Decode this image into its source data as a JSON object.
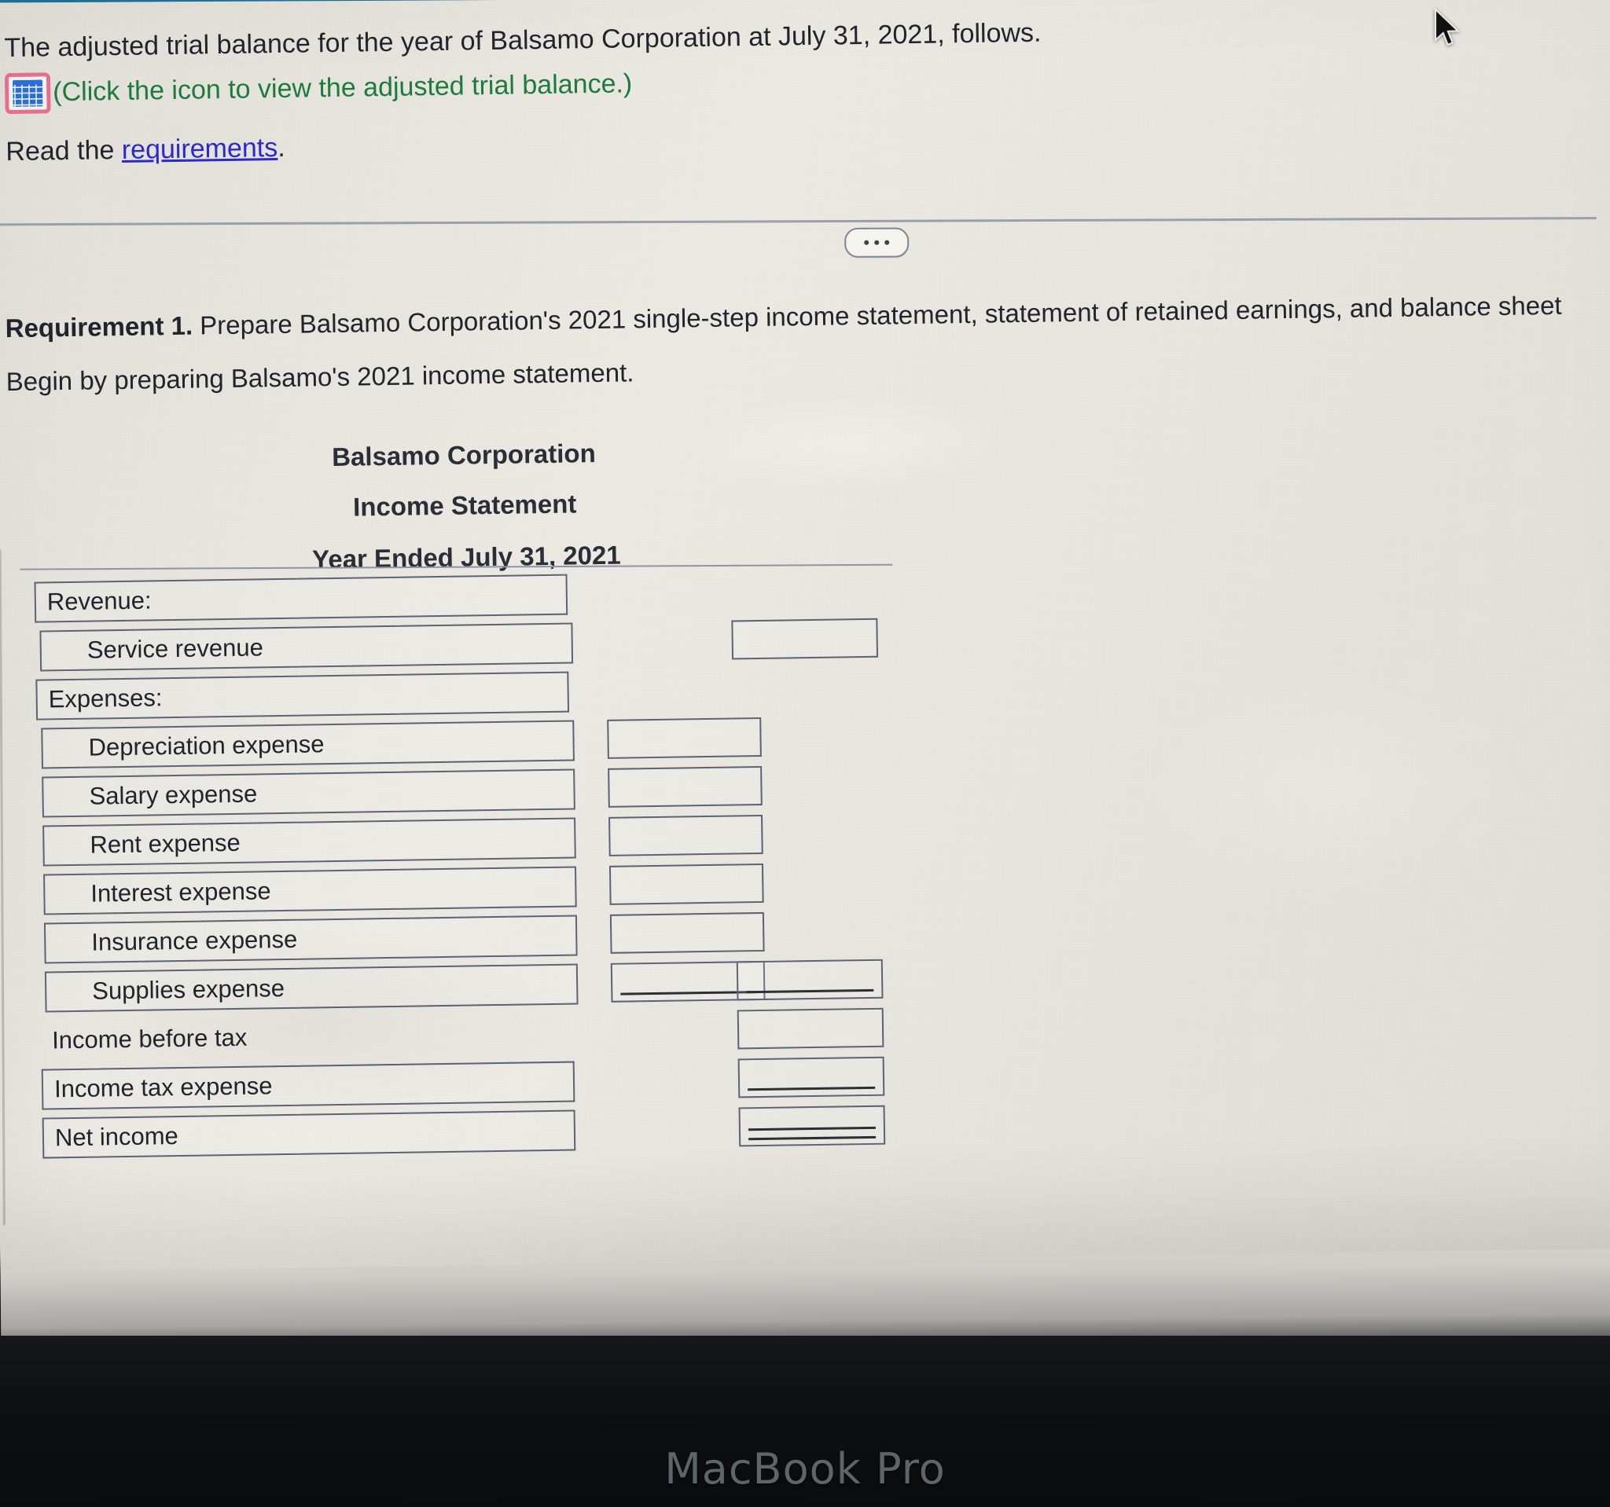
{
  "device": {
    "brand_label": "MacBook Pro"
  },
  "prompt": {
    "line1": "The adjusted trial balance for the year of Balsamo Corporation at July 31, 2021, follows.",
    "icon_name": "trial-balance-grid-icon",
    "icon_hint": "(Click the icon to view the adjusted trial balance.)",
    "read_prefix": "Read the ",
    "read_link": "requirements",
    "read_suffix": "."
  },
  "toolbar": {
    "ellipsis_label": "..."
  },
  "requirement": {
    "label": "Requirement 1.",
    "text": " Prepare Balsamo Corporation's 2021 single-step income statement, statement of retained earnings, and balance sheet",
    "begin": "Begin by preparing Balsamo's 2021 income statement."
  },
  "statement": {
    "company": "Balsamo Corporation",
    "title": "Income Statement",
    "period": "Year Ended July 31, 2021",
    "rows": [
      {
        "label": "Revenue:",
        "indent": 0,
        "boxed": true,
        "mid": false,
        "right": false,
        "underline": "none"
      },
      {
        "label": "Service revenue",
        "indent": 1,
        "boxed": true,
        "mid": false,
        "right": true,
        "underline": "none"
      },
      {
        "label": "Expenses:",
        "indent": 0,
        "boxed": true,
        "mid": false,
        "right": false,
        "underline": "none"
      },
      {
        "label": "Depreciation expense",
        "indent": 1,
        "boxed": true,
        "mid": true,
        "right": false,
        "underline": "none"
      },
      {
        "label": "Salary expense",
        "indent": 1,
        "boxed": true,
        "mid": true,
        "right": false,
        "underline": "none"
      },
      {
        "label": "Rent expense",
        "indent": 1,
        "boxed": true,
        "mid": true,
        "right": false,
        "underline": "none"
      },
      {
        "label": "Interest expense",
        "indent": 1,
        "boxed": true,
        "mid": true,
        "right": false,
        "underline": "none"
      },
      {
        "label": "Insurance expense",
        "indent": 1,
        "boxed": true,
        "mid": true,
        "right": false,
        "underline": "none"
      },
      {
        "label": "Supplies expense",
        "indent": 1,
        "boxed": true,
        "mid": true,
        "right": true,
        "underline": "single-both"
      },
      {
        "label": "Income before tax",
        "indent": 0,
        "boxed": false,
        "mid": false,
        "right": true,
        "underline": "none"
      },
      {
        "label": "Income tax expense",
        "indent": 0,
        "boxed": true,
        "mid": false,
        "right": true,
        "underline": "single-right"
      },
      {
        "label": "Net income",
        "indent": 0,
        "boxed": true,
        "mid": false,
        "right": true,
        "underline": "double-right"
      }
    ]
  },
  "colors": {
    "header_teal": "#1b7fa8",
    "icon_pink": "#e4708f",
    "icon_blue": "#2b6fd6",
    "link_blue": "#2b29c9",
    "hint_green": "#1d7a3d",
    "box_border": "#5b6374",
    "screen_bg": "#eceae3"
  }
}
